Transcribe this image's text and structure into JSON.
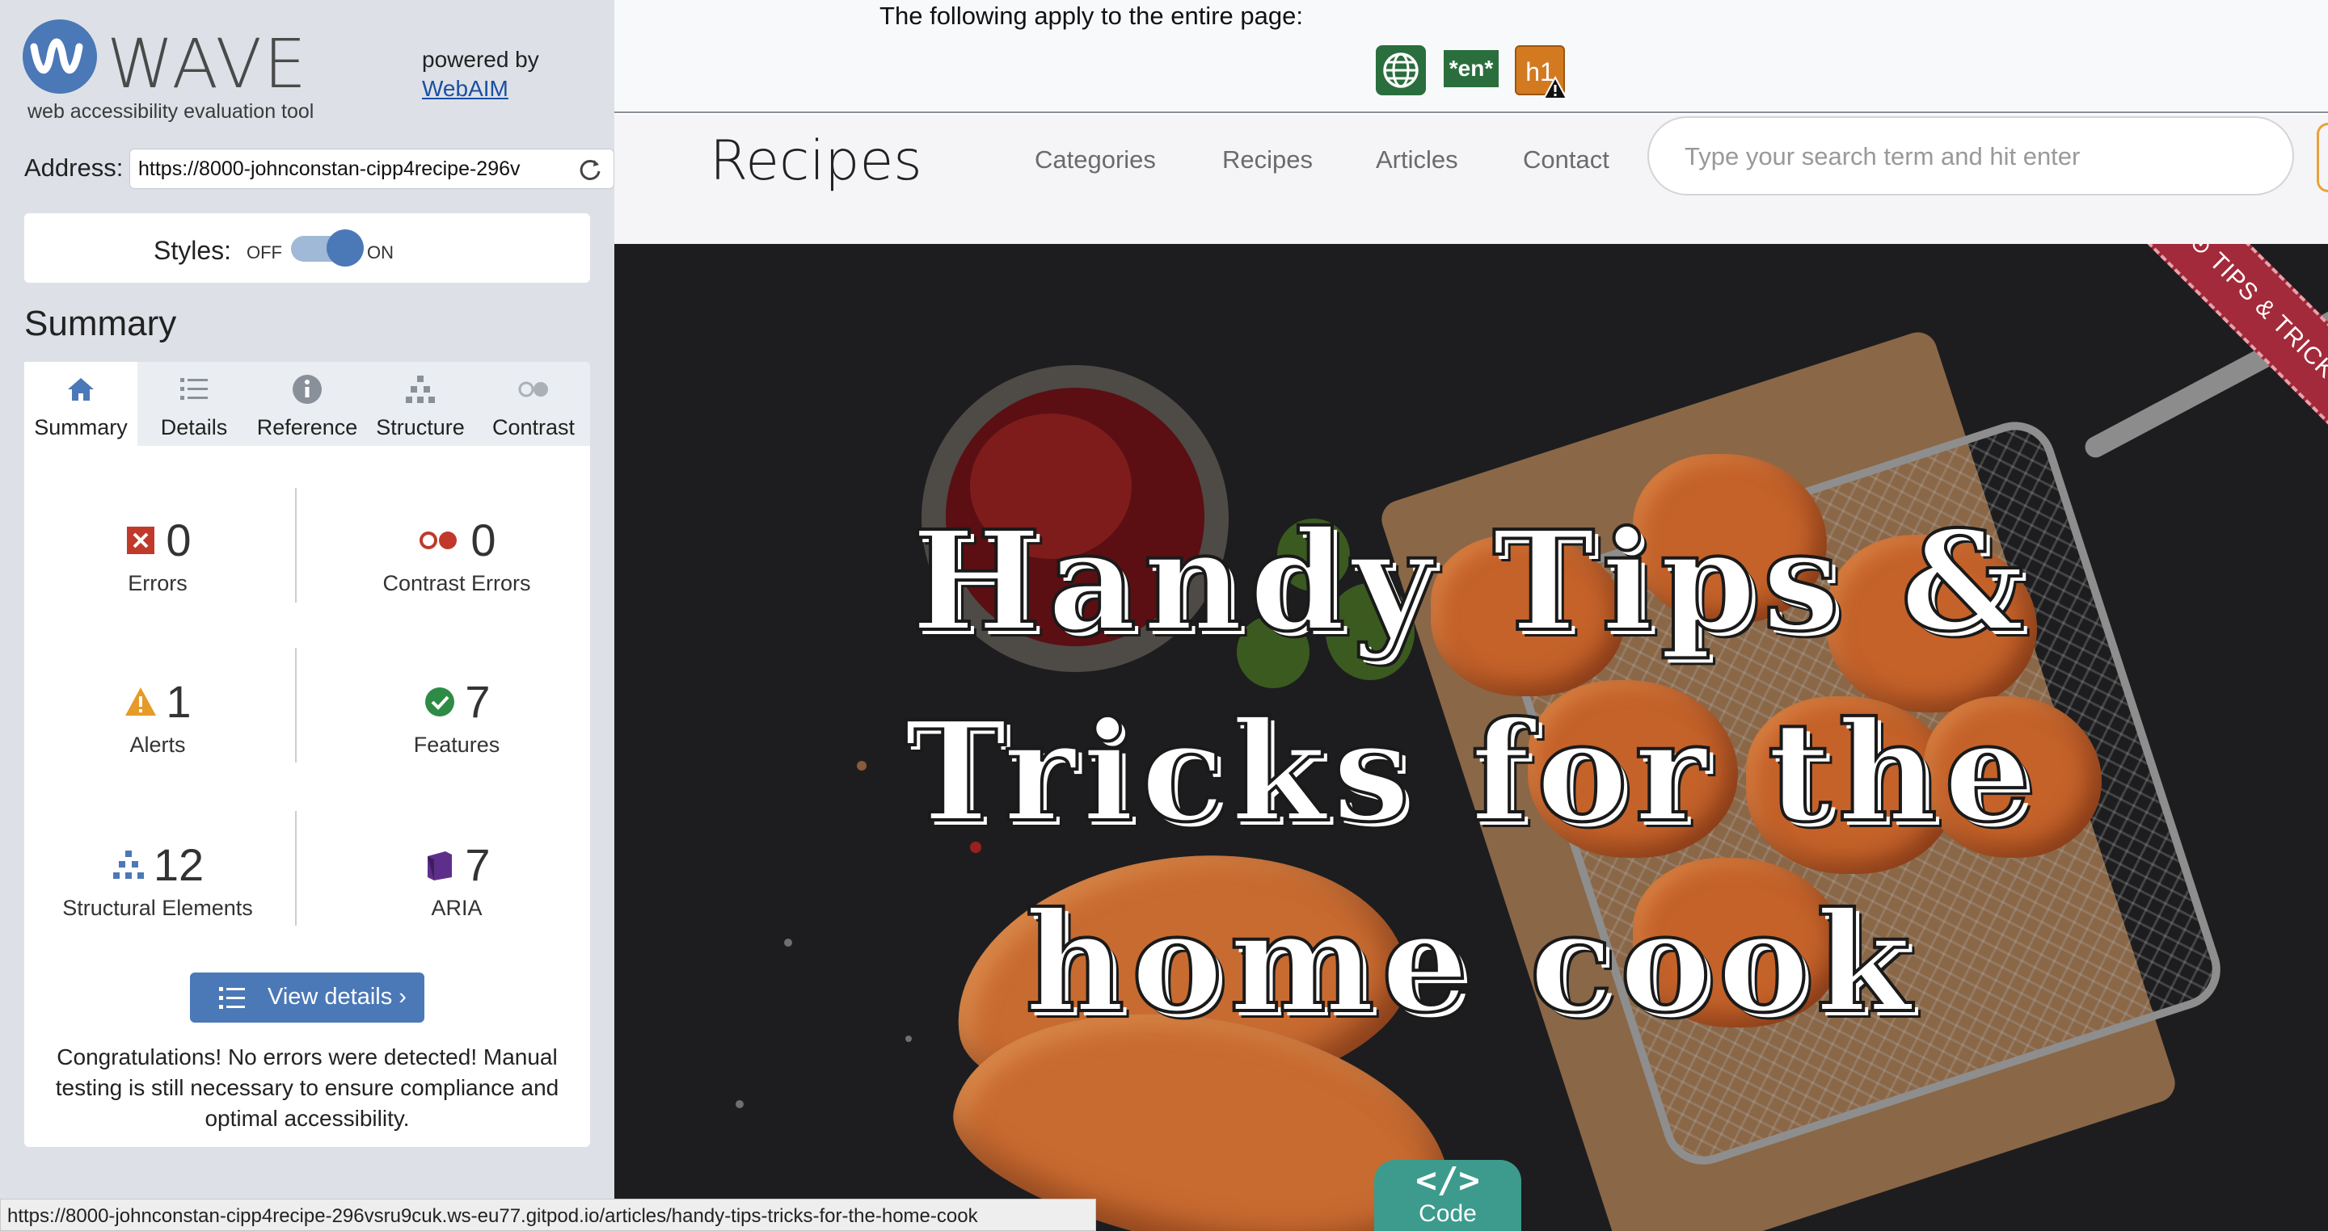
{
  "wave": {
    "brand": "WAVE",
    "tagline": "web accessibility evaluation tool",
    "powered_by": "powered by",
    "webaim_link": "WebAIM",
    "address_label": "Address:",
    "address_value": "https://8000-johnconstan-cipp4recipe-296v",
    "styles_label": "Styles:",
    "styles_off": "OFF",
    "styles_on": "ON",
    "summary_title": "Summary",
    "tabs": [
      {
        "label": "Summary",
        "icon": "home-icon",
        "active": true
      },
      {
        "label": "Details",
        "icon": "list-icon",
        "active": false
      },
      {
        "label": "Reference",
        "icon": "info-icon",
        "active": false
      },
      {
        "label": "Structure",
        "icon": "structure-icon",
        "active": false
      },
      {
        "label": "Contrast",
        "icon": "contrast-icon",
        "active": false
      }
    ],
    "stats": {
      "errors": {
        "count": "0",
        "label": "Errors",
        "icon": "error-icon",
        "color": "#c0392b"
      },
      "contrast_errors": {
        "count": "0",
        "label": "Contrast Errors",
        "icon": "contrast-error-icon",
        "color": "#c0392b"
      },
      "alerts": {
        "count": "1",
        "label": "Alerts",
        "icon": "alert-icon",
        "color": "#e69a28"
      },
      "features": {
        "count": "7",
        "label": "Features",
        "icon": "feature-icon",
        "color": "#2e8b45"
      },
      "structural": {
        "count": "12",
        "label": "Structural Elements",
        "icon": "structural-icon",
        "color": "#4b78b7"
      },
      "aria": {
        "count": "7",
        "label": "ARIA",
        "icon": "aria-icon",
        "color": "#5e2f8a"
      }
    },
    "view_details": "View details ›",
    "congrats": "Congratulations! No errors were detected! Manual testing is still necessary to ensure compliance and optimal accessibility."
  },
  "page_icons": {
    "note": "The following apply to the entire page:",
    "lang_badge": "*en*",
    "h1_badge": "h1"
  },
  "site": {
    "title": "Recipes",
    "nav": [
      "Categories",
      "Recipes",
      "Articles",
      "Contact"
    ],
    "search_placeholder": "Type your search term and hit enter",
    "ribbon": "⊙ TIPS & TRICKS",
    "headline": "Handy Tips & Tricks for the home cook"
  },
  "status_url": "https://8000-johnconstan-cipp4recipe-296vsru9cuk.ws-eu77.gitpod.io/articles/handy-tips-tricks-for-the-home-cook",
  "code_pill": {
    "glyph": "</>",
    "label": "Code"
  },
  "colors": {
    "wave_blue": "#4b78b7",
    "sidebar_bg": "#dde1e7",
    "ribbon": "#a32a3a",
    "code_teal": "#3c9b8c"
  }
}
